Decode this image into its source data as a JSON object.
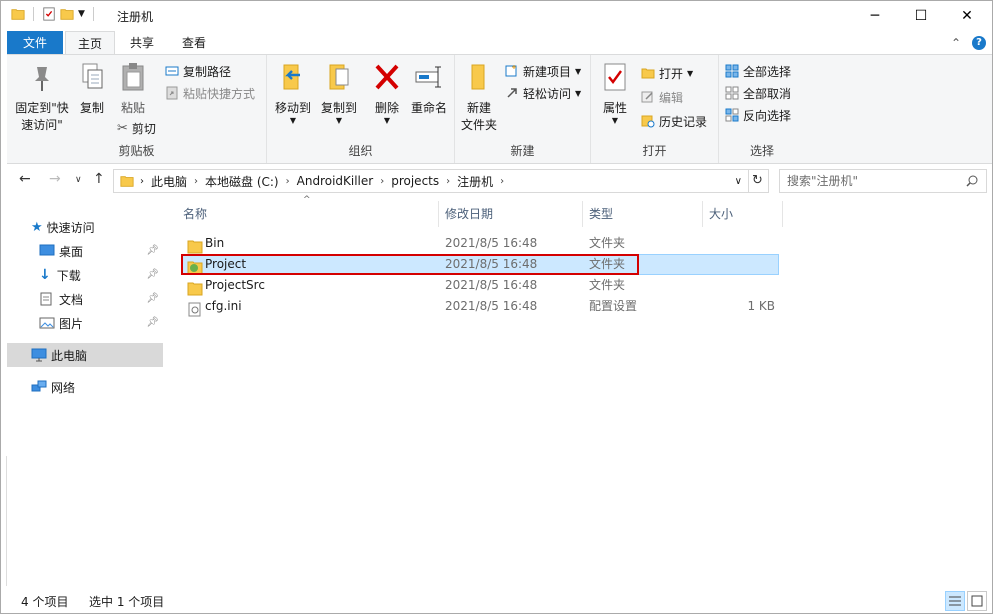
{
  "window": {
    "title": "注册机"
  },
  "window_controls": {
    "minimize": "─",
    "maximize": "☐",
    "close": "✕"
  },
  "ribbon_tabs": {
    "file": "文件",
    "home": "主页",
    "share": "共享",
    "view": "查看"
  },
  "ribbon": {
    "clipboard": {
      "label": "剪贴板",
      "pin_line1": "固定到\"快",
      "pin_line2": "速访问\"",
      "copy": "复制",
      "paste": "粘贴",
      "copy_path": "复制路径",
      "paste_shortcut": "粘贴快捷方式",
      "cut": "剪切"
    },
    "organize": {
      "label": "组织",
      "move_to": "移动到",
      "copy_to": "复制到",
      "delete": "删除",
      "rename": "重命名"
    },
    "new": {
      "label": "新建",
      "new_folder_line1": "新建",
      "new_folder_line2": "文件夹",
      "new_item": "新建项目",
      "easy_access": "轻松访问"
    },
    "open": {
      "label": "打开",
      "properties": "属性",
      "open": "打开",
      "edit": "编辑",
      "history": "历史记录"
    },
    "select": {
      "label": "选择",
      "select_all": "全部选择",
      "select_none": "全部取消",
      "invert": "反向选择"
    }
  },
  "address": {
    "breadcrumbs": [
      "此电脑",
      "本地磁盘 (C:)",
      "AndroidKiller",
      "projects",
      "注册机"
    ],
    "search_placeholder": "搜索\"注册机\""
  },
  "nav": {
    "quick_access": "快速访问",
    "desktop": "桌面",
    "downloads": "下载",
    "documents": "文档",
    "pictures": "图片",
    "this_pc": "此电脑",
    "network": "网络"
  },
  "columns": {
    "name": "名称",
    "modified": "修改日期",
    "type": "类型",
    "size": "大小"
  },
  "files": [
    {
      "name": "Bin",
      "modified": "2021/8/5 16:48",
      "type": "文件夹",
      "size": ""
    },
    {
      "name": "Project",
      "modified": "2021/8/5 16:48",
      "type": "文件夹",
      "size": ""
    },
    {
      "name": "ProjectSrc",
      "modified": "2021/8/5 16:48",
      "type": "文件夹",
      "size": ""
    },
    {
      "name": "cfg.ini",
      "modified": "2021/8/5 16:48",
      "type": "配置设置",
      "size": "1 KB"
    }
  ],
  "status": {
    "item_count": "4 个项目",
    "selected": "选中 1 个项目"
  },
  "colors": {
    "accent": "#1979ca",
    "folder": "#f8c94b",
    "selection": "#cce8ff",
    "highlight_box": "#d40000"
  }
}
